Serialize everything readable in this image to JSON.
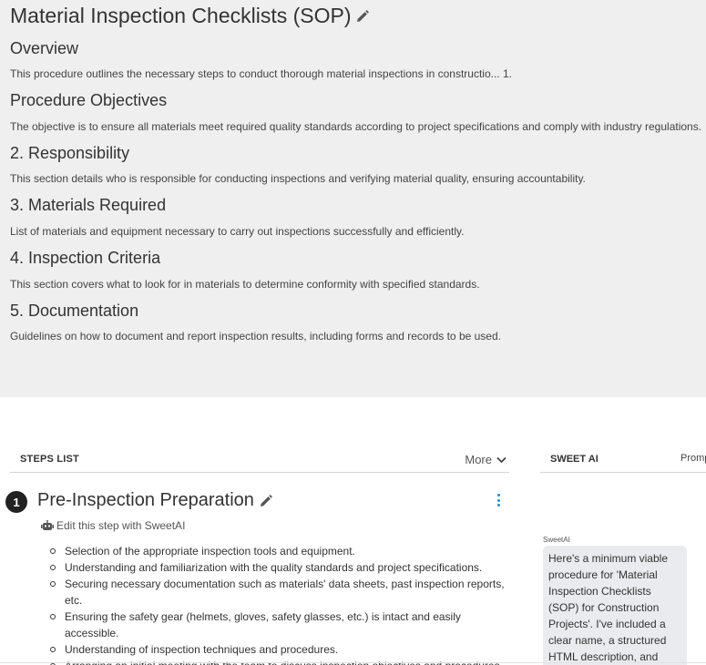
{
  "document": {
    "title": "Material Inspection Checklists (SOP)",
    "sections": [
      {
        "heading": "Overview",
        "text": "This procedure outlines the necessary steps to conduct thorough material inspections in constructio... 1."
      },
      {
        "heading": "Procedure Objectives",
        "text": "The objective is to ensure all materials meet required quality standards according to project specifications and comply with industry regulations."
      },
      {
        "heading": "2. Responsibility",
        "text": "This section details who is responsible for conducting inspections and verifying material quality, ensuring accountability."
      },
      {
        "heading": "3. Materials Required",
        "text": "List of materials and equipment necessary to carry out inspections successfully and efficiently."
      },
      {
        "heading": "4. Inspection Criteria",
        "text": "This section covers what to look for in materials to determine conformity with specified standards."
      },
      {
        "heading": "5. Documentation",
        "text": "Guidelines on how to document and report inspection results, including forms and records to be used."
      }
    ]
  },
  "steps_panel": {
    "title": "STEPS LIST",
    "more_label": "More"
  },
  "step": {
    "number": "1",
    "title": "Pre-Inspection Preparation",
    "edit_ai_label": "Edit this step with SweetAI",
    "items": [
      "Selection of the appropriate inspection tools and equipment.",
      "Understanding and familiarization with the quality standards and project specifications.",
      "Securing necessary documentation such as materials' data sheets, past inspection reports, etc.",
      "Ensuring the safety gear (helmets, gloves, safety glasses, etc.) is intact and easily accessible.",
      "Understanding of inspection techniques and procedures.",
      "Arranging an initial meeting with the team to discuss inspection objectives and procedures."
    ]
  },
  "ai_panel": {
    "tab_label": "SWEET AI",
    "secondary_tab": "Promp",
    "sender": "SweetAI",
    "message": "Here's a minimum viable procedure for 'Material Inspection Checklists (SOP) for Construction Projects'. I've included a clear name, a structured HTML description, and step"
  },
  "colors": {
    "panel_bg": "#efefef",
    "accent": "#1a8fd6",
    "bubble_bg": "#e9ebee",
    "step_badge": "#222222"
  }
}
